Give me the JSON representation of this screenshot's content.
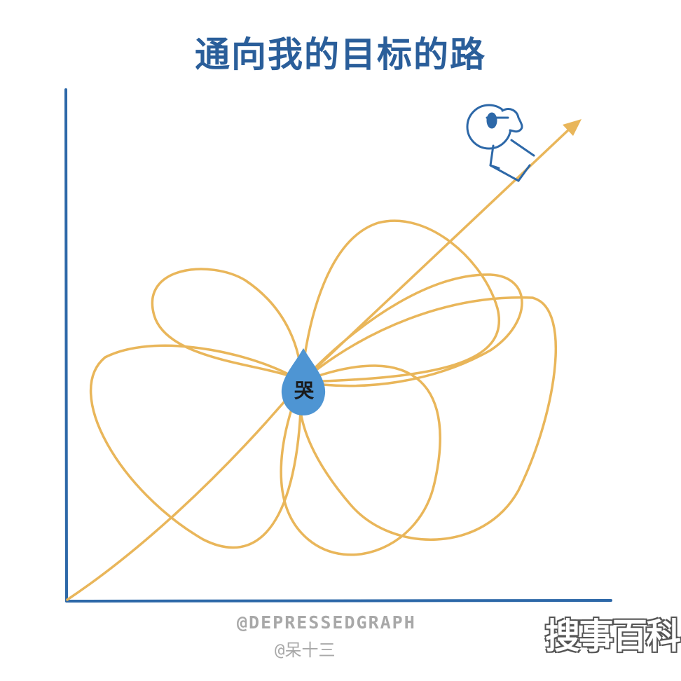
{
  "title": "通向我的目标的路",
  "center_label": "哭",
  "credit_handle": "@DEPRESSEDGRAPH",
  "credit_author": "@呆十三",
  "watermark": "搜事百科",
  "colors": {
    "title": "#2a5e9a",
    "axes": "#2d68a8",
    "path": "#e9b65a",
    "drop_fill": "#4e95d3",
    "figure": "#2d68a8"
  },
  "icons": [
    "tear-drop-icon",
    "person-icon",
    "arrow-head-icon"
  ]
}
